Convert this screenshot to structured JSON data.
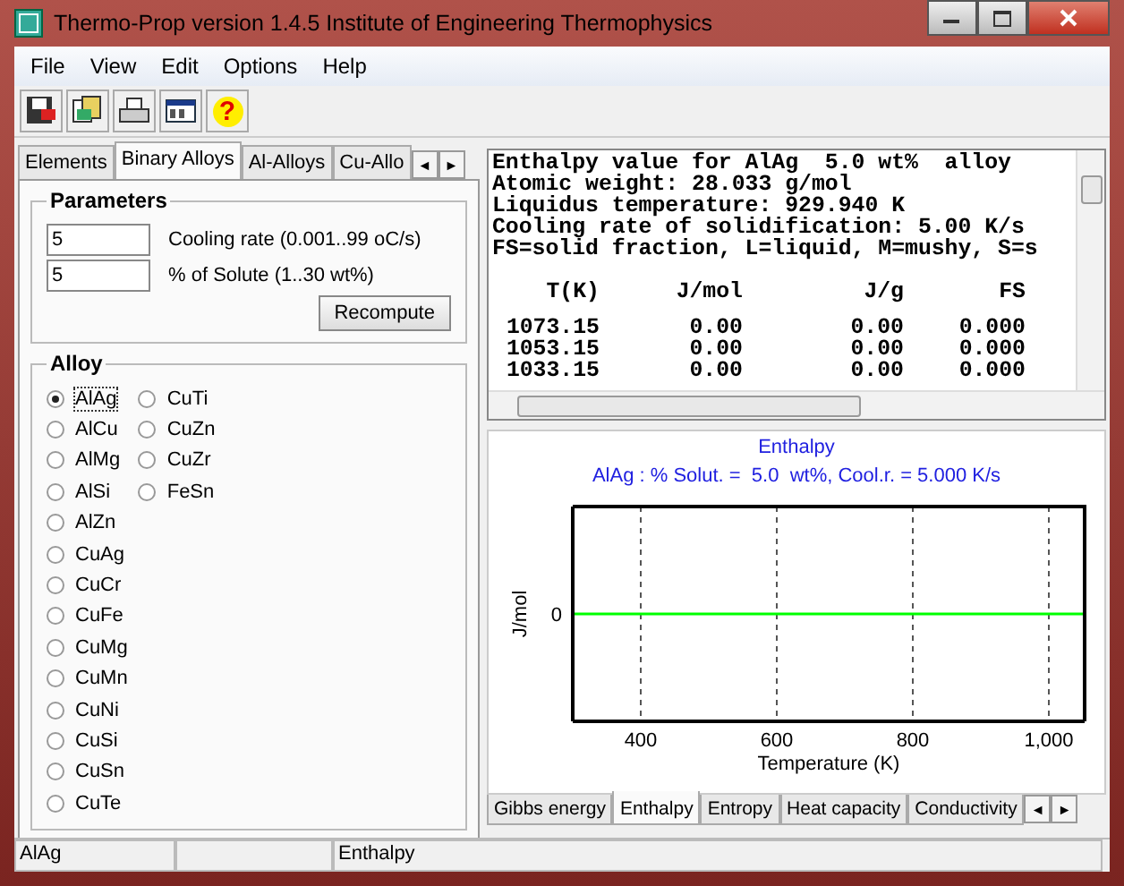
{
  "window": {
    "title": "Thermo-Prop version 1.4.5  Institute of Engineering Thermophysics"
  },
  "menu": [
    "File",
    "View",
    "Edit",
    "Options",
    "Help"
  ],
  "toolbar": [
    {
      "kind": "save"
    },
    {
      "kind": "copy"
    },
    {
      "kind": "print"
    },
    {
      "kind": "window"
    },
    {
      "kind": "help",
      "label": "?"
    }
  ],
  "tabs": [
    {
      "label": "Elements",
      "selected": false
    },
    {
      "label": "Binary Alloys",
      "selected": true
    },
    {
      "label": "Al-Alloys",
      "selected": false
    },
    {
      "label": "Cu-Allo",
      "selected": false
    }
  ],
  "tab_scroll": [
    "◄",
    "►"
  ],
  "parameters": {
    "title": "Parameters",
    "fields": [
      {
        "value": "5",
        "label": "Cooling rate (0.001..99 oC/s)"
      },
      {
        "value": "5",
        "label": "% of Solute (1..30 wt%)"
      }
    ],
    "button": "Recompute"
  },
  "alloy": {
    "title": "Alloy",
    "items": [
      {
        "label": "AlAg",
        "selected": true
      },
      {
        "label": "AlCu",
        "selected": false
      },
      {
        "label": "AlMg",
        "selected": false
      },
      {
        "label": "AlSi",
        "selected": false
      },
      {
        "label": "AlZn",
        "selected": false
      },
      {
        "label": "CuAg",
        "selected": false
      },
      {
        "label": "CuCr",
        "selected": false
      },
      {
        "label": "CuFe",
        "selected": false
      },
      {
        "label": "CuMg",
        "selected": false
      },
      {
        "label": "CuMn",
        "selected": false
      },
      {
        "label": "CuNi",
        "selected": false
      },
      {
        "label": "CuSi",
        "selected": false
      },
      {
        "label": "CuSn",
        "selected": false
      },
      {
        "label": "CuTe",
        "selected": false
      },
      {
        "label": "CuTi",
        "selected": false
      },
      {
        "label": "CuZn",
        "selected": false
      },
      {
        "label": "CuZr",
        "selected": false
      },
      {
        "label": "FeSn",
        "selected": false
      }
    ]
  },
  "output": {
    "lines": [
      "Enthalpy value for AlAg  5.0 wt%  alloy",
      "Atomic weight: 28.033 g/mol",
      "Liquidus temperature: 929.940 K",
      "Cooling rate of solidification: 5.00 K/s",
      "FS=solid fraction, L=liquid, M=mushy, S=s"
    ],
    "columns": [
      "T(K)",
      "J/mol",
      "J/g",
      "FS"
    ],
    "rows": [
      [
        "1073.15",
        "0.00",
        "0.00",
        "0.000"
      ],
      [
        "1053.15",
        "0.00",
        "0.00",
        "0.000"
      ],
      [
        "1033.15",
        "0.00",
        "0.00",
        "0.000"
      ]
    ]
  },
  "chart": {
    "title": "Enthalpy",
    "subtitle": "AlAg : % Solut. =  5.0  wt%, Cool.r. = 5.000 K/s",
    "xlabel": "Temperature (K)",
    "ylabel": "J/mol",
    "x_tick_labels": [
      "400",
      "600",
      "800",
      "1,000"
    ],
    "y_tick_label": "0"
  },
  "bottom_tabs": [
    {
      "label": "Gibbs energy",
      "selected": false
    },
    {
      "label": "Enthalpy",
      "selected": true
    },
    {
      "label": "Entropy",
      "selected": false
    },
    {
      "label": "Heat capacity",
      "selected": false
    },
    {
      "label": "Conductivity",
      "selected": false
    }
  ],
  "status_bar": [
    "AlAg",
    "Enthalpy"
  ]
}
